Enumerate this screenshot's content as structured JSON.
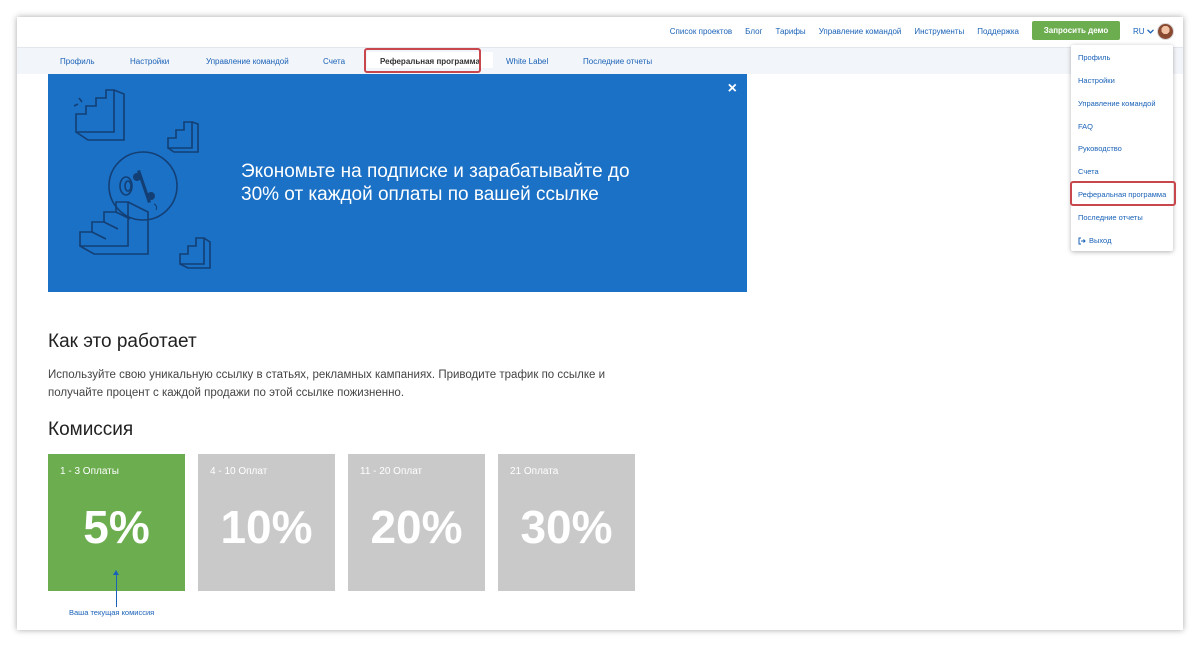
{
  "topnav": {
    "links": [
      "Список проектов",
      "Блог",
      "Тарифы",
      "Управление командой",
      "Инструменты",
      "Поддержка"
    ],
    "demo_button": "Запросить демо",
    "lang": "RU"
  },
  "subnav": {
    "tabs": [
      "Профиль",
      "Настройки",
      "Управление командой",
      "Счета",
      "Реферальная программа",
      "White Label",
      "Последние отчеты"
    ],
    "active": "Реферальная программа"
  },
  "banner": {
    "title": "Экономьте на подписке и зарабатывайте до 30% от каждой оплаты по вашей ссылке",
    "close": "×"
  },
  "how": {
    "heading": "Как это работает",
    "text": "Используйте свою уникальную ссылку в статьях, рекламных кампаниях. Приводите трафик по ссылке и получайте процент с каждой продажи по этой ссылке пожизненно."
  },
  "commission": {
    "heading": "Комиссия",
    "tiers": [
      {
        "label": "1 - 3 Оплаты",
        "percent": "5%",
        "current": true
      },
      {
        "label": "4 - 10 Оплат",
        "percent": "10%",
        "current": false
      },
      {
        "label": "11 - 20 Оплат",
        "percent": "20%",
        "current": false
      },
      {
        "label": "21 Оплата",
        "percent": "30%",
        "current": false
      }
    ],
    "current_note": "Ваша текущая комиссия"
  },
  "dropdown": {
    "items": [
      "Профиль",
      "Настройки",
      "Управление командой",
      "FAQ",
      "Руководство",
      "Счета",
      "Реферальная программа",
      "Последние отчеты",
      "Выход"
    ]
  },
  "colors": {
    "accent": "#1a62b8",
    "banner": "#1b71c6",
    "green": "#6cad4f",
    "grey_card": "#c9c9c9",
    "highlight": "#c8474d"
  }
}
